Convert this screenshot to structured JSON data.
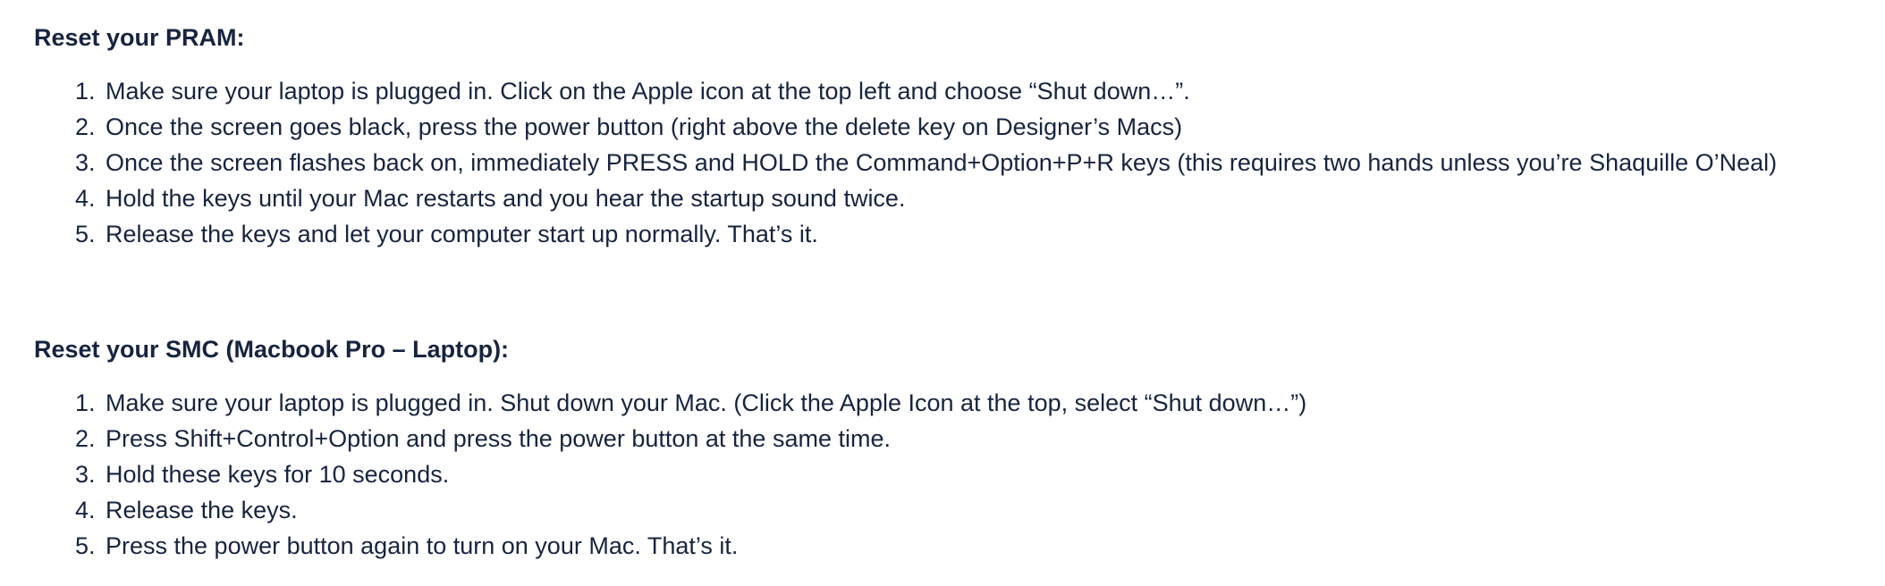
{
  "sections": [
    {
      "heading": "Reset your PRAM:",
      "steps": [
        {
          "num": "1.",
          "text": "Make sure your laptop is plugged in. Click on the Apple icon at the top left and choose “Shut down…”."
        },
        {
          "num": "2.",
          "text": "Once the screen goes black, press the power button (right above the delete key on Designer’s Macs)"
        },
        {
          "num": "3.",
          "text": "Once the screen flashes back on, immediately PRESS and HOLD the Command+Option+P+R keys (this requires two hands unless you’re Shaquille O’Neal)"
        },
        {
          "num": "4.",
          "text": "Hold the keys until your Mac restarts and you hear the startup sound twice."
        },
        {
          "num": "5.",
          "text": "Release the keys and let your computer start up normally. That’s it."
        }
      ]
    },
    {
      "heading": "Reset your SMC (Macbook Pro – Laptop):",
      "steps": [
        {
          "num": "1.",
          "text": "Make sure your laptop is plugged in. Shut down your Mac. (Click the Apple Icon at the top, select “Shut down…”)"
        },
        {
          "num": "2.",
          "text": "Press Shift+Control+Option and press the power button at the same time."
        },
        {
          "num": "3.",
          "text": "Hold these keys for 10 seconds."
        },
        {
          "num": "4.",
          "text": "Release the keys."
        },
        {
          "num": "5.",
          "text": "Press the power button again to turn on your Mac. That’s it."
        }
      ]
    }
  ]
}
